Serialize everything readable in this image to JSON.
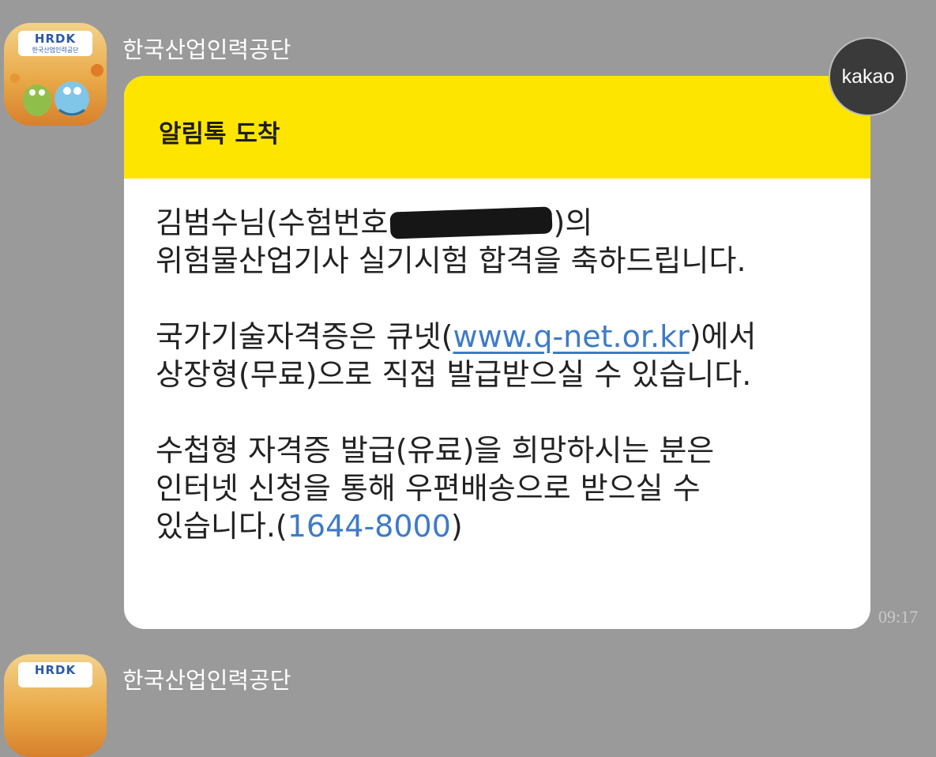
{
  "colors": {
    "background": "#9a9a9a",
    "header_yellow": "#fee500",
    "bubble_white": "#ffffff",
    "link_blue": "#3e7bc8",
    "badge_dark": "#3a3a3a"
  },
  "messages": [
    {
      "sender": "한국산업인력공단",
      "avatar_logo": "HRDK",
      "avatar_sub": "한국산업인력공단",
      "badge": "kakao",
      "header_title": "알림톡 도착",
      "body": {
        "p1_l1_before": "김범수님(수험번호",
        "p1_l1_after": ")의",
        "p1_l2": "위험물산업기사 실기시험 합격을 축하드립니다.",
        "p2_l1_before": "국가기술자격증은 큐넷(",
        "p2_link": "www.q-net.or.kr",
        "p2_l1_after": ")에서",
        "p2_l2": "상장형(무료)으로 직접 발급받으실 수 있습니다.",
        "p3_l1": "수첩형 자격증 발급(유료)을 희망하시는 분은",
        "p3_l2": "인터넷 신청을 통해 우편배송으로 받으실 수",
        "p3_l3_before": "있습니다.(",
        "p3_phone": "1644-8000",
        "p3_l3_after": ")"
      },
      "time": "09:17"
    },
    {
      "sender": "한국산업인력공단",
      "avatar_logo": "HRDK"
    }
  ]
}
